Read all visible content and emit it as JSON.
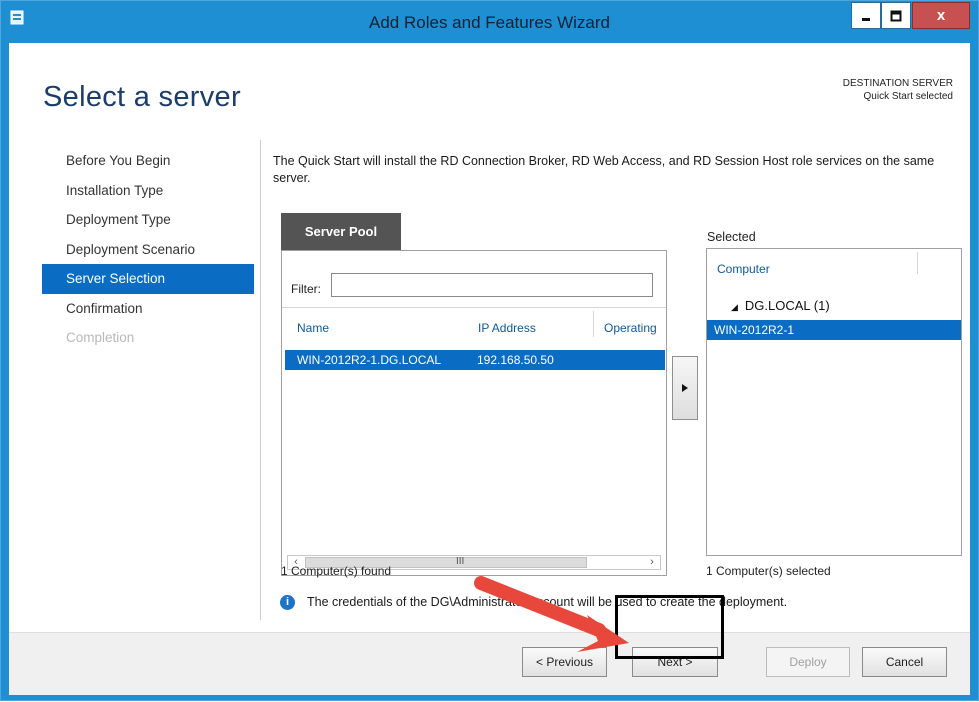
{
  "window": {
    "title": "Add Roles and Features Wizard",
    "controls": {
      "minimize": "_",
      "maximize": "□",
      "close": "x"
    }
  },
  "header": {
    "page_title": "Select a server",
    "destination_label": "DESTINATION SERVER",
    "destination_value": "Quick Start selected"
  },
  "steps": [
    {
      "label": "Before You Begin",
      "state": "normal"
    },
    {
      "label": "Installation Type",
      "state": "normal"
    },
    {
      "label": "Deployment Type",
      "state": "normal"
    },
    {
      "label": "Deployment Scenario",
      "state": "normal"
    },
    {
      "label": "Server Selection",
      "state": "active"
    },
    {
      "label": "Confirmation",
      "state": "normal"
    },
    {
      "label": "Completion",
      "state": "disabled"
    }
  ],
  "main": {
    "intro": "The Quick Start will install the RD Connection Broker, RD Web Access, and RD Session Host role services on the same server.",
    "pool": {
      "tab_label": "Server Pool",
      "filter_label": "Filter:",
      "filter_value": "",
      "columns": [
        "Name",
        "IP Address",
        "Operating"
      ],
      "rows": [
        {
          "name": "WIN-2012R2-1.DG.LOCAL",
          "ip": "192.168.50.50",
          "os": ""
        }
      ],
      "found_text": "1 Computer(s) found"
    },
    "add_button_glyph": "▶",
    "selected": {
      "label": "Selected",
      "column": "Computer",
      "group": "DG.LOCAL (1)",
      "rows": [
        "WIN-2012R2-1"
      ],
      "count_text": "1 Computer(s) selected"
    },
    "info_text": "The credentials of the DG\\Administrator account will be used to create the deployment."
  },
  "footer": {
    "previous": "< Previous",
    "next": "Next >",
    "deploy": "Deploy",
    "cancel": "Cancel"
  },
  "colors": {
    "titlebar": "#1e8fd3",
    "selection": "#0a6cc3",
    "annotation_arrow": "#e8483c"
  }
}
